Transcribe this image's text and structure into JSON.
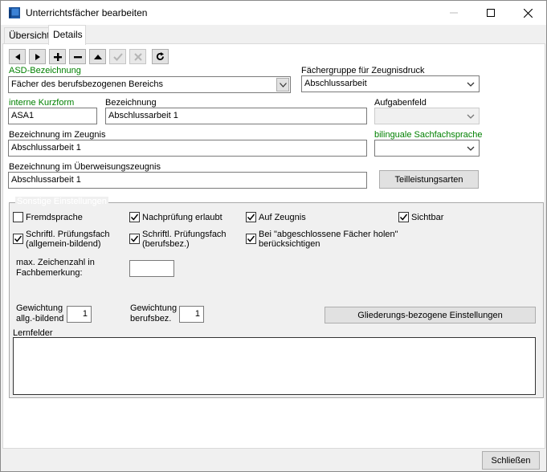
{
  "window": {
    "title": "Unterrichtsfächer bearbeiten",
    "minimize_icon": "minimize-icon",
    "maximize_icon": "maximize-icon",
    "close_icon": "close-icon"
  },
  "tabs": [
    {
      "label": "Übersicht",
      "active": false
    },
    {
      "label": "Details",
      "active": true
    }
  ],
  "toolbar": {
    "buttons": [
      "prev-icon",
      "next-icon",
      "add-icon",
      "remove-icon",
      "up-icon",
      "confirm-icon",
      "cancel-icon",
      "refresh-icon"
    ]
  },
  "form": {
    "asd_label": "ASD-Bezeichnung",
    "asd_value": "Fächer des berufsbezogenen Bereichs",
    "faechergruppe_label": "Fächergruppe für Zeugnisdruck",
    "faechergruppe_value": "Abschlussarbeit",
    "kurzform_label": "interne Kurzform",
    "kurzform_value": "ASA1",
    "bezeichnung_label": "Bezeichnung",
    "bezeichnung_value": "Abschlussarbeit 1",
    "aufgabenfeld_label": "Aufgabenfeld",
    "aufgabenfeld_value": "",
    "zeugnis_label": "Bezeichnung im Zeugnis",
    "zeugnis_value": "Abschlussarbeit 1",
    "bilingual_label": "bilinguale Sachfachsprache",
    "bilingual_value": "",
    "ueberweisung_label": "Bezeichnung im Überweisungszeugnis",
    "ueberweisung_value": "Abschlussarbeit 1",
    "teilleistung_button": "Teilleistungsarten"
  },
  "sonstige": {
    "title": "Sonstige Einstellungen",
    "fremdsprache": {
      "label": "Fremdsprache",
      "checked": false
    },
    "nachpruefung": {
      "label": "Nachprüfung erlaubt",
      "checked": true
    },
    "auf_zeugnis": {
      "label": "Auf Zeugnis",
      "checked": true
    },
    "sichtbar": {
      "label": "Sichtbar",
      "checked": true
    },
    "pruef_allg": {
      "label_line1": "Schriftl. Prüfungsfach",
      "label_line2": "(allgemein-bildend)",
      "checked": true
    },
    "pruef_beruf": {
      "label_line1": "Schriftl. Prüfungsfach",
      "label_line2": "(berufsbez.)",
      "checked": true
    },
    "abgeschlossen": {
      "label_line1": "Bei \"abgeschlossene Fächer holen\"",
      "label_line2": "berücksichtigen",
      "checked": true
    },
    "zeichenzahl_line1": "max. Zeichenzahl in",
    "zeichenzahl_line2": "Fachbemerkung:",
    "zeichenzahl_value": "",
    "gewichtung_allg_line1": "Gewichtung",
    "gewichtung_allg_line2": "allg.-bildend",
    "gewichtung_allg_value": "1",
    "gewichtung_beruf_line1": "Gewichtung",
    "gewichtung_beruf_line2": "berufsbez.",
    "gewichtung_beruf_value": "1",
    "gliederung_button": "Gliederungs-bezogene Einstellungen",
    "lernfelder_label": "Lernfelder",
    "lernfelder_value": ""
  },
  "footer": {
    "close_button": "Schließen"
  },
  "colors": {
    "green_label": "#008000",
    "title_icon": "#1e5aa8"
  }
}
